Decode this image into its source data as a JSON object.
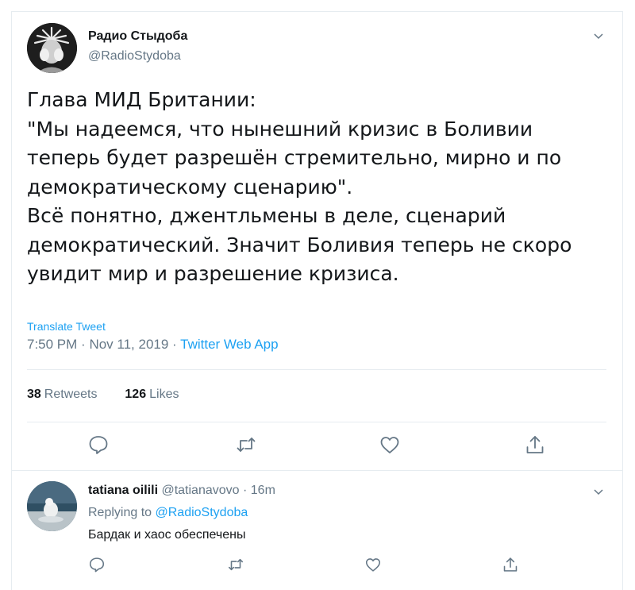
{
  "tweet": {
    "author_name": "Радио Стыдоба",
    "author_handle": "@RadioStydoba",
    "text_lines": [
      "Глава МИД Британии:",
      "\"Мы надеемся, что нынешний кризис в Боливии",
      "теперь будет разрешён стремительно, мирно и по",
      "демократическому сценарию\".",
      "Всё понятно, джентльмены в деле, сценарий",
      "демократический. Значит Боливия теперь не скоро",
      "увидит мир и разрешение кризиса."
    ],
    "translate_label": "Translate Tweet",
    "time": "7:50 PM",
    "date": "Nov 11, 2019",
    "source_app": "Twitter Web App",
    "retweets_count": "38",
    "retweets_label": "Retweets",
    "likes_count": "126",
    "likes_label": "Likes"
  },
  "reply": {
    "author_name": "tatiana oilili",
    "author_handle": "@tatianavovo",
    "time": "16m",
    "replying_prefix": "Replying to",
    "replying_mention": "@RadioStydoba",
    "text": "Бардак и хаос обеспечены"
  },
  "icons": {
    "reply": "speech-bubble-icon",
    "retweet": "retweet-icon",
    "like": "heart-icon",
    "share": "share-icon",
    "menu": "chevron-down-icon"
  },
  "colors": {
    "link": "#1da1f2",
    "secondary_text": "#657786",
    "primary_text": "#14171a",
    "divider": "#e6ecf0"
  }
}
